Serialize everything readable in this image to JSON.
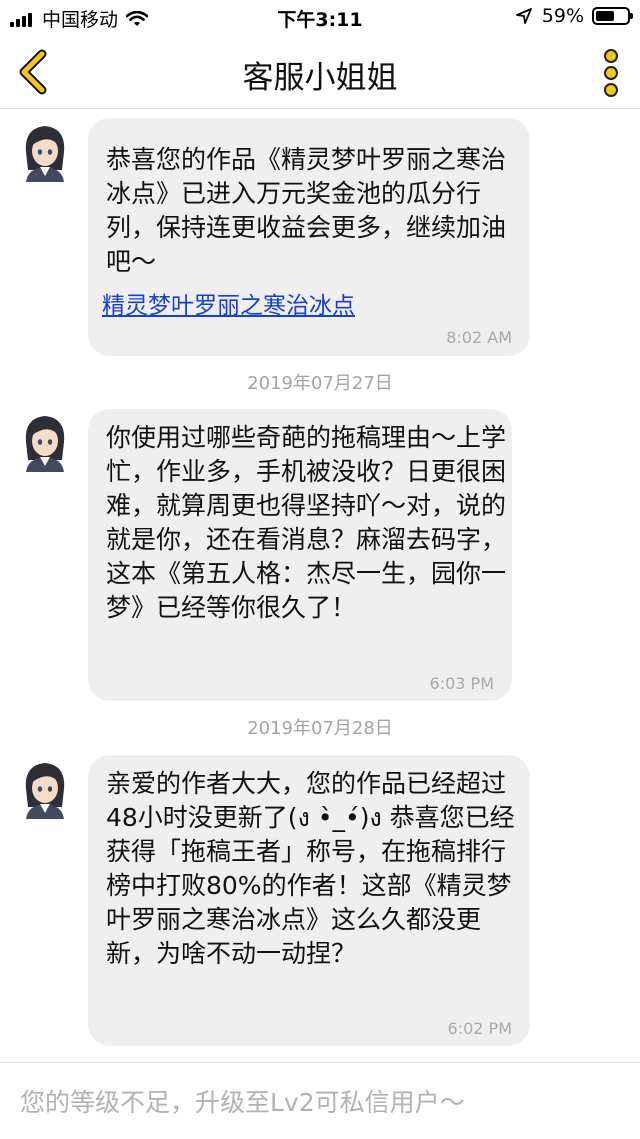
{
  "status_bar": {
    "carrier": "中国移动",
    "time": "下午3:11",
    "battery_text": "59%",
    "battery_level": 0.59
  },
  "nav": {
    "title": "客服小姐姐",
    "accent": "#f2c81a"
  },
  "messages": [
    {
      "text": "恭喜您的作品《精灵梦叶罗丽之寒治冰点》已进入万元奖金池的瓜分行列，保持连更收益会更多，继续加油吧～",
      "link": "精灵梦叶罗丽之寒治冰点",
      "time": "8:02 AM"
    },
    {
      "text": "你使用过哪些奇葩的拖稿理由～上学忙，作业多，手机被没收？日更很困难，就算周更也得坚持吖～对，说的就是你，还在看消息？麻溜去码字，这本《第五人格：杰尽一生，园你一梦》已经等你很久了！",
      "time": "6:03 PM"
    },
    {
      "text": "亲爱的作者大大，您的作品已经超过48小时没更新了(ง •̀_•́)ง 恭喜您已经获得「拖稿王者」称号，在拖稿排行榜中打败80%的作者！这部《精灵梦叶罗丽之寒治冰点》这么久都没更新，为啥不动一动捏？",
      "time": "6:02 PM"
    }
  ],
  "dates": [
    "2019年07月27日",
    "2019年07月28日"
  ],
  "input": {
    "placeholder": "您的等级不足，升级至Lv2可私信用户～"
  }
}
